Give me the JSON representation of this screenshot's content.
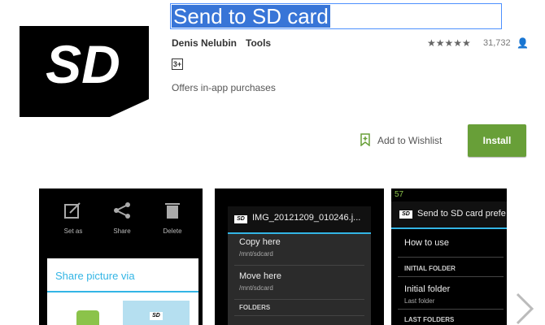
{
  "app": {
    "title": "Send to SD card",
    "developer": "Denis Nelubin",
    "category": "Tools",
    "rating_stars": "★★★★★",
    "rating_count": "31,732",
    "content_rating": "3+",
    "iap_note": "Offers in-app purchases",
    "wishlist_label": "Add to Wishlist",
    "install_label": "Install",
    "icon": "sd-card-icon",
    "install_color": "#689f38",
    "accent_color": "#33b5e5"
  },
  "screenshots": {
    "shot1": {
      "toolbar": [
        "Set as",
        "Share",
        "Delete"
      ],
      "dialog_title": "Share picture via"
    },
    "shot2": {
      "filename": "IMG_20121209_010246.j...",
      "items": [
        {
          "label": "Copy here",
          "path": "/mnt/sdcard"
        },
        {
          "label": "Move here",
          "path": "/mnt/sdcard"
        }
      ],
      "section": "FOLDERS"
    },
    "shot3": {
      "status": "57",
      "bar_title": "Send to SD card prefe",
      "how_to_use": "How to use",
      "section_initial": "INITIAL FOLDER",
      "initial_folder": "Initial folder",
      "initial_folder_sub": "Last folder",
      "section_last": "LAST FOLDERS"
    }
  }
}
